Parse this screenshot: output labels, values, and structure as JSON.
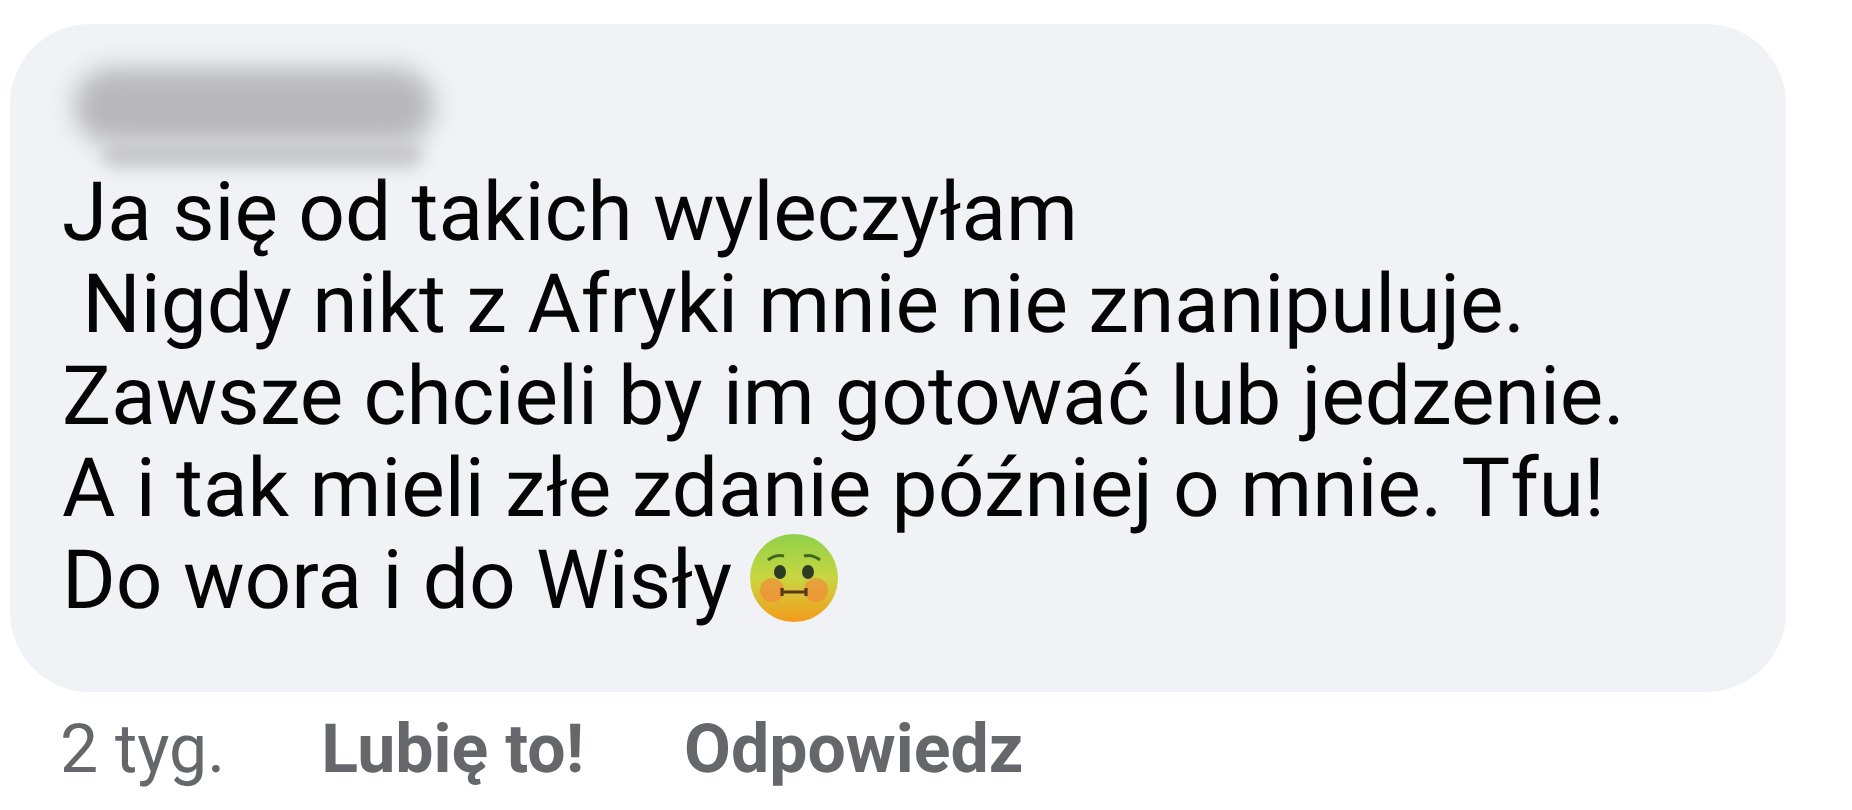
{
  "comment": {
    "author_hidden": true,
    "lines": [
      "Ja się od takich wyleczyłam",
      " Nigdy nikt z Afryki mnie nie znanipuluje.",
      "Zawsze chcieli by im gotować lub jedzenie.",
      "A i tak mieli złe zdanie później o mnie. Tfu!",
      "Do wora i do Wisły"
    ],
    "trailing_emoji": {
      "kind": "nauseated"
    }
  },
  "footer": {
    "time": "2 tyg.",
    "actions": [
      "Lubię to!",
      "Odpowiedz"
    ]
  }
}
